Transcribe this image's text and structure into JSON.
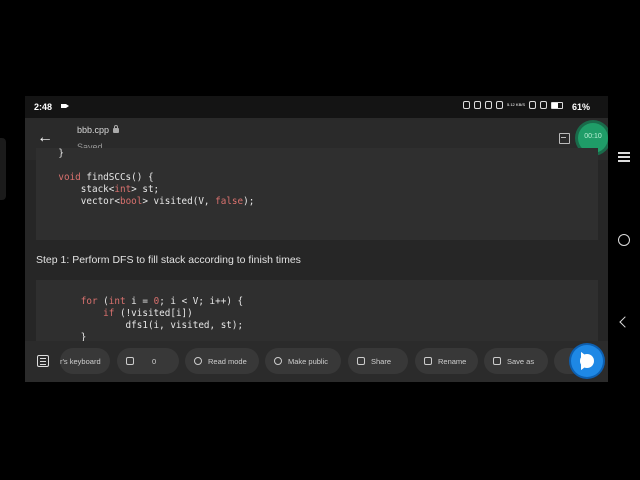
{
  "status_bar": {
    "time": "2:48",
    "network": "5.12 KB/S",
    "battery": "61%"
  },
  "header": {
    "filename": "bbb.cpp",
    "saved_label": "Saved",
    "timer": "00:10"
  },
  "code_block_1": [
    "    }",
    "",
    "    void findSCCs() {",
    "        stack<int> st;",
    "        vector<bool> visited(V, false);"
  ],
  "step_text": "Step 1: Perform DFS to fill stack according to finish times",
  "code_block_2": [
    "        for (int i = 0; i < V; i++) {",
    "            if (!visited[i])",
    "                dfs1(i, visited, st);",
    "        }"
  ],
  "toolbar": {
    "keyboard": "r's keyboard",
    "comment_count": "0",
    "read_mode": "Read mode",
    "make_public": "Make public",
    "share": "Share",
    "rename": "Rename",
    "save_as": "Save as"
  }
}
